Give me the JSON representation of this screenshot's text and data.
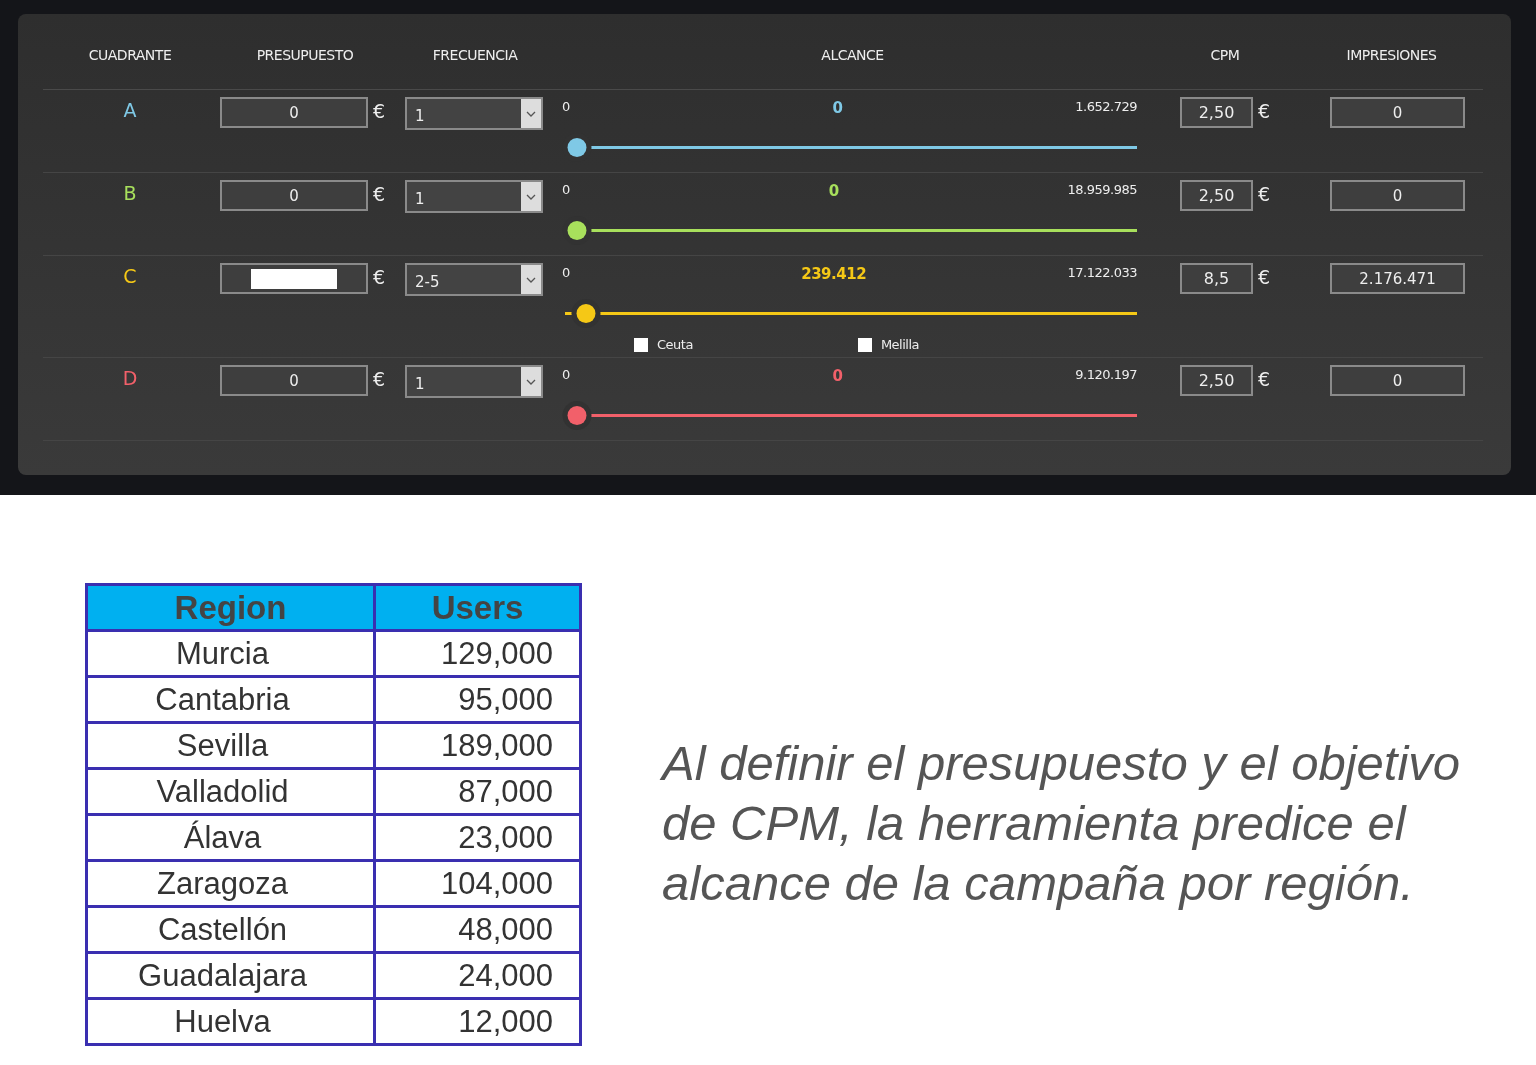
{
  "panel": {
    "columns": [
      "CUADRANTE",
      "PRESUPUESTO",
      "FRECUENCIA",
      "ALCANCE",
      "CPM",
      "IMPRESIONES"
    ],
    "rows": [
      {
        "quadrant": "A",
        "color": "#7fc9e6",
        "budget": "0",
        "budget_highlighted": false,
        "budget_unit": "€",
        "frequency": "1",
        "reach_min": "0",
        "reach": "0",
        "reach_max": "1.652.729",
        "level": 0,
        "cpm": "2,50",
        "cpm_unit": "€",
        "impressions": "0"
      },
      {
        "quadrant": "B",
        "color": "#a8e05c",
        "budget": "0",
        "budget_highlighted": false,
        "budget_unit": "€",
        "frequency": "1",
        "reach_min": "0",
        "reach": "0",
        "reach_max": "18.959.985",
        "level": 0,
        "cpm": "2,50",
        "cpm_unit": "€",
        "impressions": "0"
      },
      {
        "quadrant": "C",
        "color": "#f5c816",
        "budget_highlighted": true,
        "budget_unit": "€",
        "frequency": "2-5",
        "reach_min": "0",
        "reach": "239.412",
        "reach_max": "17.122.033",
        "level": 0.016,
        "cpm": "8,5",
        "cpm_unit": "€",
        "impressions": "2.176.471",
        "options": [
          {
            "label": "Ceuta",
            "checked": false
          },
          {
            "label": "Melilla",
            "checked": false
          }
        ]
      },
      {
        "quadrant": "D",
        "color": "#f2606a",
        "budget": "0",
        "budget_highlighted": false,
        "budget_unit": "€",
        "frequency": "1",
        "reach_min": "0",
        "reach": "0",
        "reach_max": "9.120.197",
        "level": 0,
        "cpm": "2,50",
        "cpm_unit": "€",
        "impressions": "0"
      }
    ]
  },
  "table": {
    "columns": [
      "Region",
      "Users"
    ],
    "rows": [
      [
        "Murcia",
        "129,000"
      ],
      [
        "Cantabria",
        "95,000"
      ],
      [
        "Sevilla",
        "189,000"
      ],
      [
        "Valladolid",
        "87,000"
      ],
      [
        "Álava",
        "23,000"
      ],
      [
        "Zaragoza",
        "104,000"
      ],
      [
        "Castellón",
        "48,000"
      ],
      [
        "Guadalajara",
        "24,000"
      ],
      [
        "Huelva",
        "12,000"
      ]
    ]
  },
  "caption": "Al definir el presupuesto y el objetivo de CPM, la herramienta predice el alcance de la campaña por región."
}
